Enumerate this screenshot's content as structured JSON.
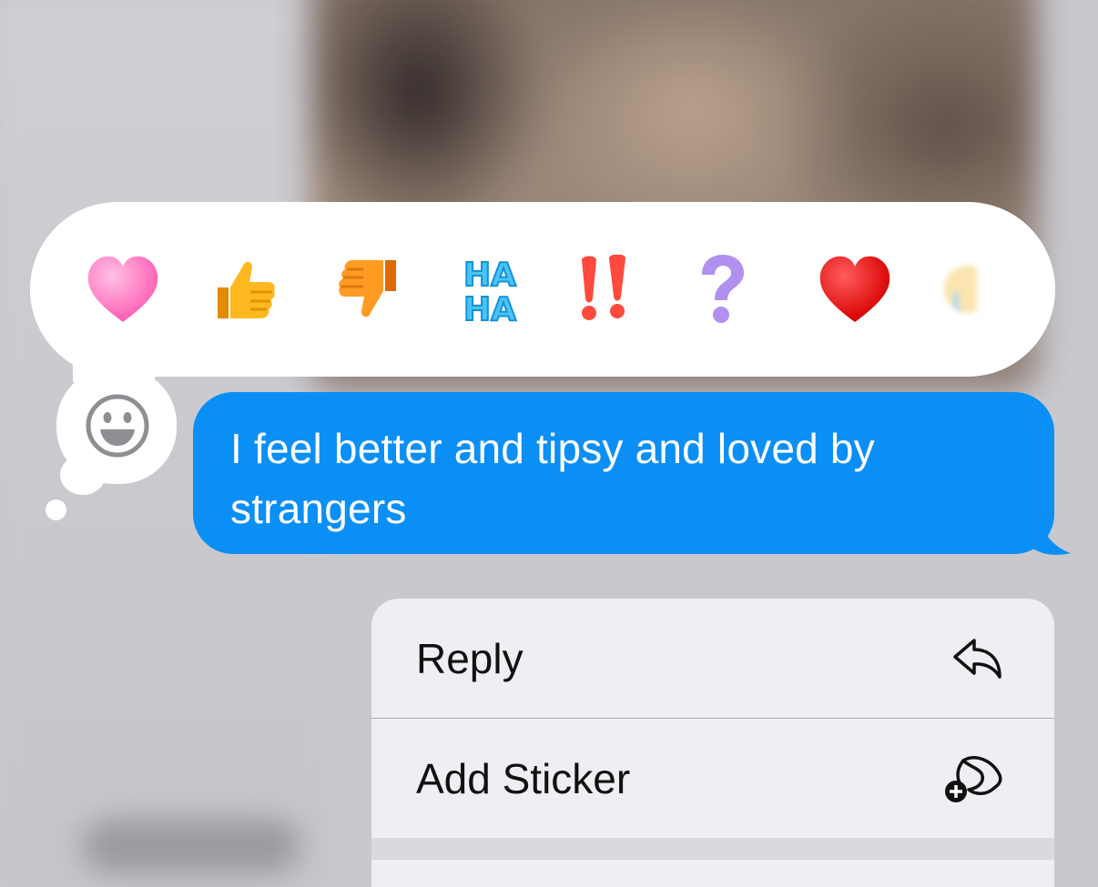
{
  "tapback": {
    "reactions": [
      {
        "name": "pink-heart",
        "label": "Pink Heart"
      },
      {
        "name": "thumbs-up",
        "label": "Like"
      },
      {
        "name": "thumbs-down",
        "label": "Dislike"
      },
      {
        "name": "haha",
        "label": "HA HA"
      },
      {
        "name": "exclamation",
        "label": "!!"
      },
      {
        "name": "question",
        "label": "?"
      },
      {
        "name": "red-heart",
        "label": "Love"
      },
      {
        "name": "more-emoji",
        "label": ""
      }
    ],
    "haha_line1": "HA",
    "haha_line2": "HA"
  },
  "emoji_picker": {
    "icon": "smiley-face-icon"
  },
  "message": {
    "text": "I feel better and tipsy and loved by strangers",
    "color": "#0a8ff6"
  },
  "menu": {
    "items": [
      {
        "label": "Reply",
        "icon": "reply-arrow-icon"
      },
      {
        "label": "Add Sticker",
        "icon": "add-sticker-icon"
      }
    ]
  }
}
